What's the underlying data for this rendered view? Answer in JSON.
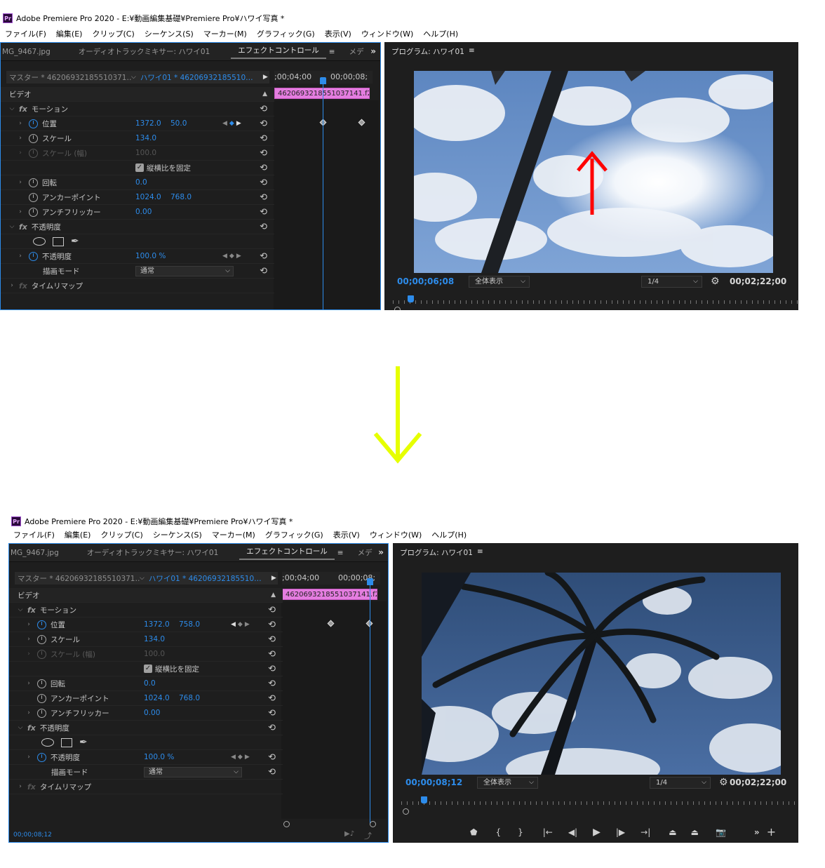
{
  "app": {
    "title": "Adobe Premiere Pro 2020 - E:¥動画編集基礎¥Premiere Pro¥ハワイ写真 *",
    "logo_text": "Pr"
  },
  "menu": [
    "ファイル(F)",
    "編集(E)",
    "クリップ(C)",
    "シーケンス(S)",
    "マーカー(M)",
    "グラフィック(G)",
    "表示(V)",
    "ウィンドウ(W)",
    "ヘルプ(H)"
  ],
  "panel_tabs": {
    "project_item": "MG_9467.jpg",
    "audio_mixer": "オーディオトラックミキサー: ハワイ01",
    "effect_controls": "エフェクトコントロール",
    "media": "メデ",
    "menu_icon": "≡",
    "overflow_icon": "»"
  },
  "effect_controls": {
    "master_label": "マスター * 46206932185510371…",
    "sequence_label": "ハワイ01 * 46206932185510…",
    "video_header": "ビデオ",
    "motion": "モーション",
    "position": "位置",
    "scale": "スケール",
    "scale_width": "スケール (幅)",
    "uniform_scale": "縦横比を固定",
    "rotation": "回転",
    "anchor_point": "アンカーポイント",
    "anti_flicker": "アンチフリッカー",
    "opacity_section": "不透明度",
    "opacity": "不透明度",
    "blend_mode": "描画モード",
    "time_remap": "タイムリマップ",
    "values": {
      "scale": "134.0",
      "scale_width": "100.0",
      "rotation": "0.0",
      "anchor_x": "1024.0",
      "anchor_y": "768.0",
      "anti_flicker": "0.00",
      "opacity": "100.0 %",
      "blend_mode": "通常"
    },
    "clip_name": "462069321855103714​1.f2e"
  },
  "states": {
    "before": {
      "position_x": "1372.0",
      "position_y": "50.0",
      "ruler_left": ";00;04;00",
      "ruler_right": "00;00;08;",
      "clip_label": "4620693218551037141.f2e",
      "program_timecode": "00;00;06;08",
      "playhead_fraction": 0.57
    },
    "after": {
      "position_x": "1372.0",
      "position_y": "758.0",
      "ruler_left": ";00;04;00",
      "ruler_right": "00;00;08;",
      "clip_label": "4620693218551037141.f2e",
      "program_timecode": "00;00;08;12",
      "ec_timecode": "00;00;08;12",
      "playhead_fraction": 0.98
    }
  },
  "program_monitor": {
    "title": "プログラム: ハワイ01",
    "zoom": "全体表示",
    "resolution": "1/4",
    "duration": "00;02;22;00"
  },
  "colors": {
    "accent_blue": "#2d8ceb",
    "clip_pink": "#e57de0",
    "annotation_red": "#ff0000",
    "transition_arrow": "#e6ff00"
  },
  "icons": {
    "reset": "⟲",
    "wrench": "🔧",
    "play": "▶"
  }
}
